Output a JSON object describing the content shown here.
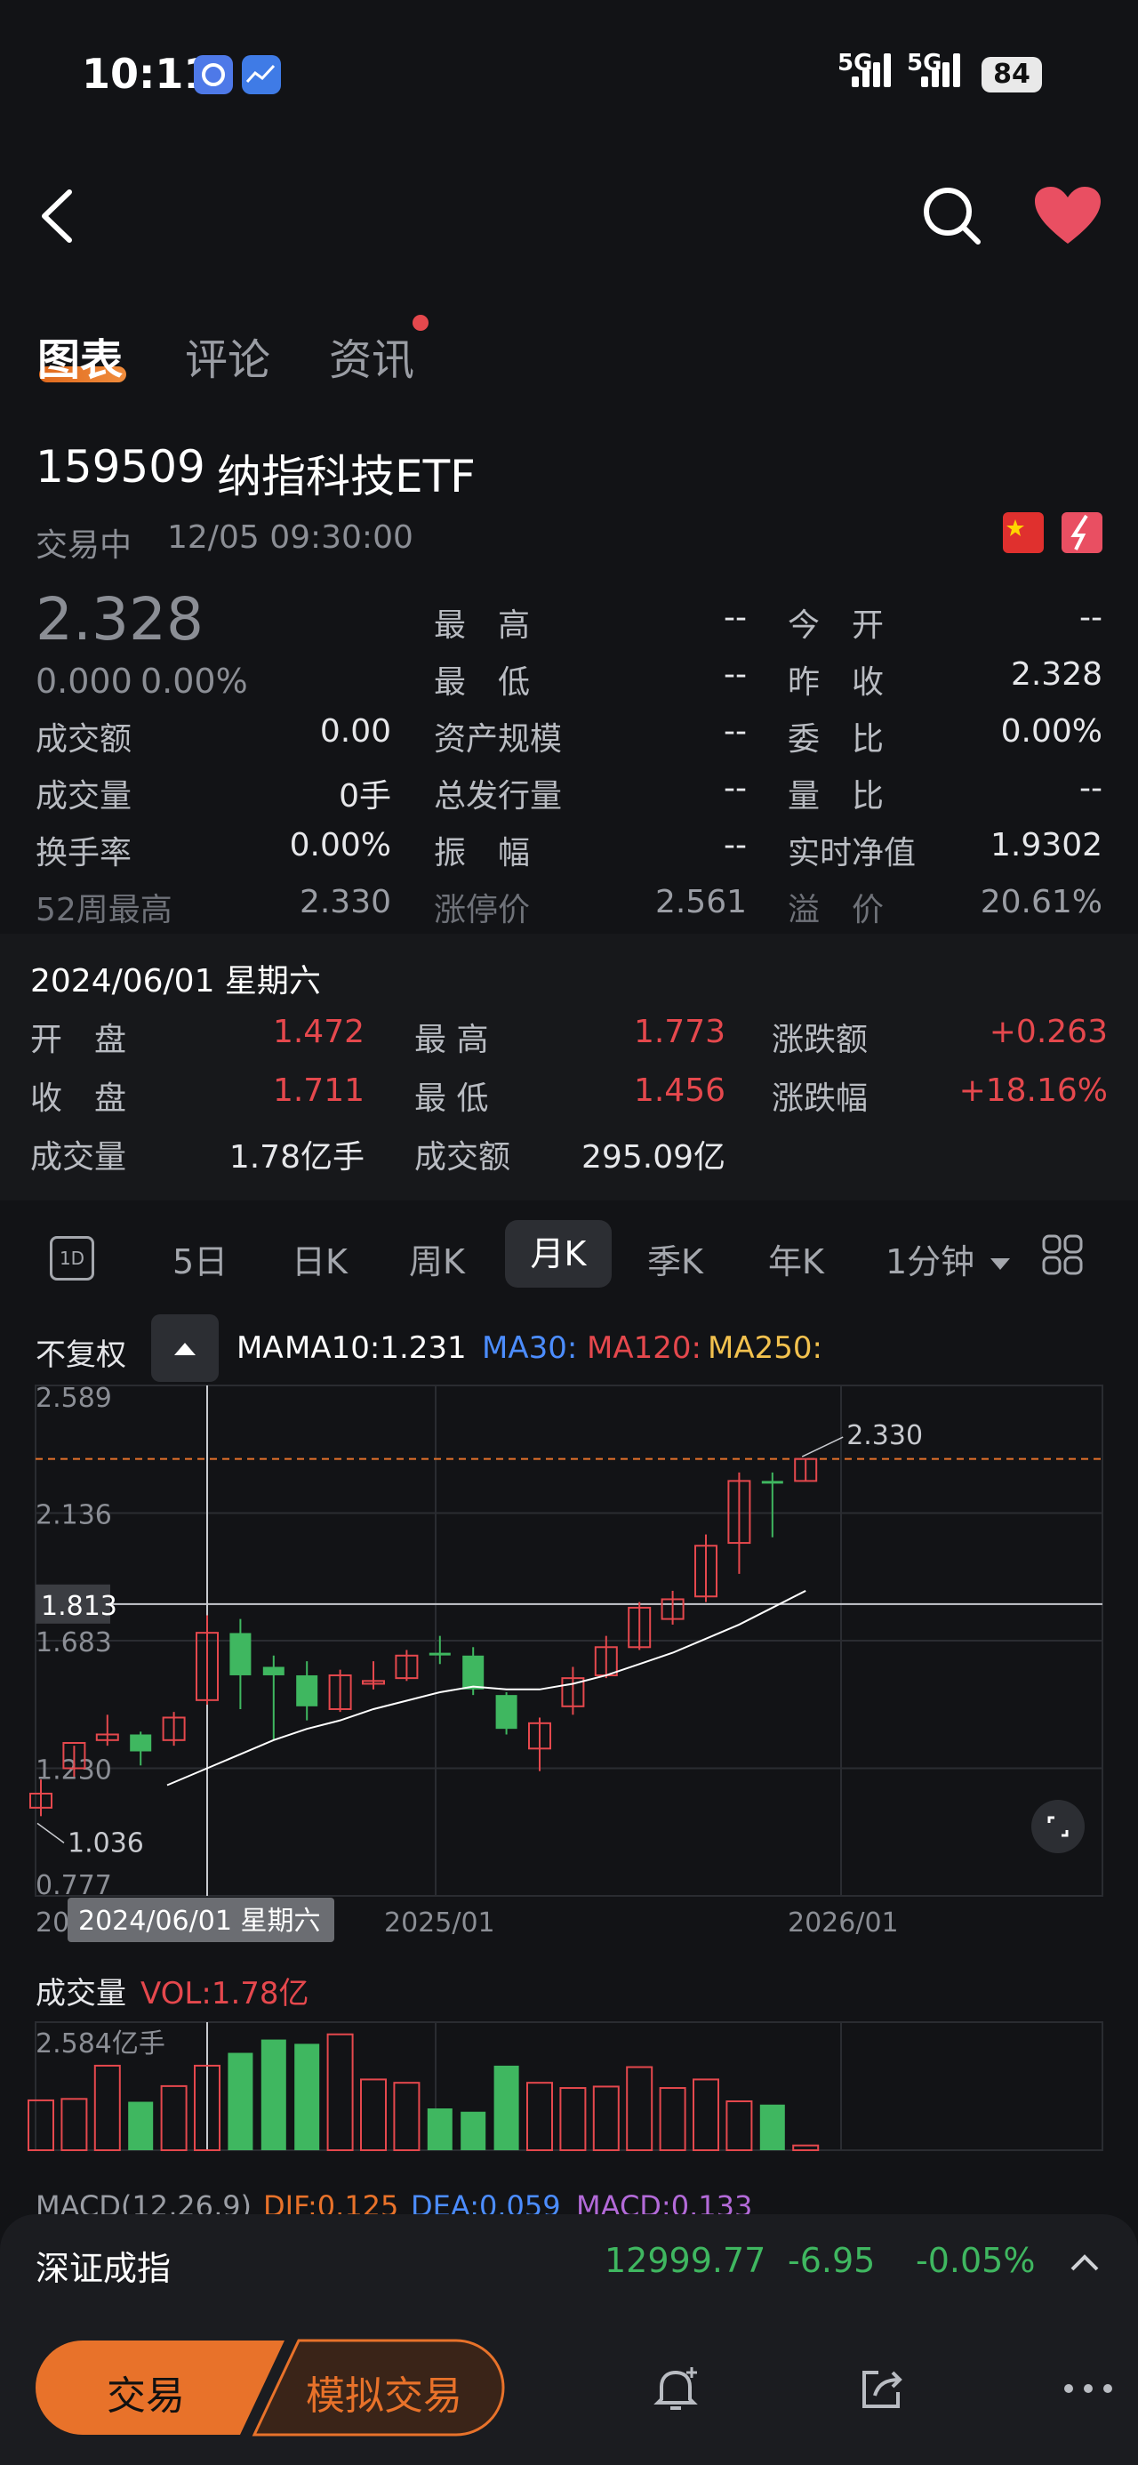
{
  "status_bar": {
    "time": "10:11",
    "signal1": "5G",
    "signal2": "5G",
    "battery": "84"
  },
  "tabs": [
    {
      "label": "图表"
    },
    {
      "label": "评论"
    },
    {
      "label": "资讯"
    }
  ],
  "security": {
    "code": "159509",
    "name": "纳指科技ETF",
    "status": "交易中",
    "datetime": "12/05 09:30:00",
    "price": "2.328",
    "change": "0.000",
    "change_pct": "0.00%"
  },
  "quote": {
    "high_label": "最　高",
    "high": "--",
    "open_label": "今　开",
    "open": "--",
    "low_label": "最　低",
    "low": "--",
    "prev_close_label": "昨　收",
    "prev_close": "2.328",
    "amount_label": "成交额",
    "amount": "0.00",
    "asset_label": "资产规模",
    "asset": "--",
    "ratio_label": "委　比",
    "ratio": "0.00%",
    "volume_label": "成交量",
    "volume": "0手",
    "issue_label": "总发行量",
    "issue": "--",
    "vol_ratio_label": "量　比",
    "vol_ratio": "--",
    "turnover_label": "换手率",
    "turnover": "0.00%",
    "amplitude_label": "振　幅",
    "amplitude": "--",
    "nav_label": "实时净值",
    "nav": "1.9302",
    "w52_label": "52周最高",
    "w52": "2.330",
    "limit_label": "涨停价",
    "limit": "2.561",
    "premium_label": "溢　价",
    "premium": "20.61%"
  },
  "detail": {
    "date": "2024/06/01 星期六",
    "open_label": "开　盘",
    "open": "1.472",
    "high_label": "最 高",
    "high": "1.773",
    "chg_label": "涨跌额",
    "chg": "+0.263",
    "close_label": "收　盘",
    "close": "1.711",
    "low_label": "最 低",
    "low": "1.456",
    "chg_pct_label": "涨跌幅",
    "chg_pct": "+18.16%",
    "vol_label": "成交量",
    "vol": "1.78亿手",
    "amt_label": "成交额",
    "amt": "295.09亿"
  },
  "period_tabs": {
    "d1": "1D",
    "five_day": "5日",
    "day_k": "日K",
    "week_k": "周K",
    "month_k": "月K",
    "quarter_k": "季K",
    "year_k": "年K",
    "minute": "1分钟"
  },
  "chart_header": {
    "adjust": "不复权",
    "ma": "MA",
    "ma10": "MA10:1.231",
    "ma30": "MA30:",
    "ma120": "MA120:",
    "ma250": "MA250:"
  },
  "colors": {
    "up": "#e5484d",
    "down": "#3fb760",
    "ma10": "#ffffff",
    "ma30": "#4c8dff",
    "ma120": "#e5484d",
    "ma250": "#f2c14e",
    "accent": "#e8722a"
  },
  "chart_data": {
    "type": "candlestick",
    "y_ticks": [
      "2.589",
      "2.136",
      "1.683",
      "1.230",
      "0.777"
    ],
    "ylim": [
      0.777,
      2.589
    ],
    "x_ticks": [
      "2025/01",
      "2026/01"
    ],
    "x_start_partial": "20",
    "crosshair_value": "1.813",
    "crosshair_date": "2024/06/01 星期六",
    "max_label": "2.330",
    "min_label": "1.036",
    "current_price": 2.328,
    "candles": [
      {
        "o": 1.14,
        "h": 1.19,
        "l": 1.06,
        "c": 1.09,
        "dir": "up"
      },
      {
        "o": 1.23,
        "h": 1.31,
        "l": 1.2,
        "c": 1.32,
        "dir": "up"
      },
      {
        "o": 1.33,
        "h": 1.42,
        "l": 1.31,
        "c": 1.35,
        "dir": "up"
      },
      {
        "o": 1.35,
        "h": 1.36,
        "l": 1.24,
        "c": 1.29,
        "dir": "down"
      },
      {
        "o": 1.33,
        "h": 1.43,
        "l": 1.31,
        "c": 1.41,
        "dir": "up"
      },
      {
        "o": 1.472,
        "h": 1.773,
        "l": 1.456,
        "c": 1.711,
        "dir": "up"
      },
      {
        "o": 1.71,
        "h": 1.76,
        "l": 1.44,
        "c": 1.56,
        "dir": "down"
      },
      {
        "o": 1.59,
        "h": 1.63,
        "l": 1.33,
        "c": 1.56,
        "dir": "down"
      },
      {
        "o": 1.56,
        "h": 1.61,
        "l": 1.4,
        "c": 1.45,
        "dir": "down"
      },
      {
        "o": 1.44,
        "h": 1.58,
        "l": 1.43,
        "c": 1.56,
        "dir": "up"
      },
      {
        "o": 1.53,
        "h": 1.61,
        "l": 1.51,
        "c": 1.54,
        "dir": "up"
      },
      {
        "o": 1.55,
        "h": 1.65,
        "l": 1.54,
        "c": 1.63,
        "dir": "up"
      },
      {
        "o": 1.64,
        "h": 1.7,
        "l": 1.6,
        "c": 1.64,
        "dir": "down"
      },
      {
        "o": 1.63,
        "h": 1.66,
        "l": 1.49,
        "c": 1.51,
        "dir": "down"
      },
      {
        "o": 1.49,
        "h": 1.5,
        "l": 1.35,
        "c": 1.37,
        "dir": "down"
      },
      {
        "o": 1.3,
        "h": 1.41,
        "l": 1.22,
        "c": 1.39,
        "dir": "up"
      },
      {
        "o": 1.45,
        "h": 1.59,
        "l": 1.42,
        "c": 1.55,
        "dir": "up"
      },
      {
        "o": 1.56,
        "h": 1.7,
        "l": 1.55,
        "c": 1.66,
        "dir": "up"
      },
      {
        "o": 1.66,
        "h": 1.82,
        "l": 1.65,
        "c": 1.8,
        "dir": "up"
      },
      {
        "o": 1.76,
        "h": 1.86,
        "l": 1.74,
        "c": 1.83,
        "dir": "up"
      },
      {
        "o": 1.84,
        "h": 2.06,
        "l": 1.82,
        "c": 2.02,
        "dir": "up"
      },
      {
        "o": 2.03,
        "h": 2.28,
        "l": 1.92,
        "c": 2.25,
        "dir": "up"
      },
      {
        "o": 2.25,
        "h": 2.28,
        "l": 2.05,
        "c": 2.25,
        "dir": "down"
      },
      {
        "o": 2.25,
        "h": 2.33,
        "l": 2.25,
        "c": 2.328,
        "dir": "up"
      }
    ],
    "ma10": [
      null,
      null,
      null,
      null,
      null,
      1.23,
      1.28,
      1.33,
      1.37,
      1.4,
      1.44,
      1.47,
      1.5,
      1.52,
      1.51,
      1.51,
      1.53,
      1.56,
      1.6,
      1.64,
      1.69,
      1.74,
      1.8,
      1.86
    ],
    "volume": {
      "label": "成交量",
      "value_label": "VOL:1.78亿",
      "max_label": "2.584亿手",
      "values": [
        1.05,
        1.08,
        1.78,
        1.02,
        1.35,
        1.78,
        2.05,
        2.33,
        2.24,
        2.44,
        1.49,
        1.42,
        0.88,
        0.81,
        1.78,
        1.42,
        1.31,
        1.34,
        1.75,
        1.31,
        1.49,
        1.03,
        0.96,
        0.1
      ],
      "dirs": [
        "up",
        "up",
        "up",
        "down",
        "up",
        "up",
        "down",
        "down",
        "down",
        "up",
        "up",
        "up",
        "down",
        "down",
        "down",
        "up",
        "up",
        "up",
        "up",
        "up",
        "up",
        "up",
        "down",
        "up"
      ]
    }
  },
  "macd": {
    "label": "MACD(12,26,9)",
    "dif": "DIF:0.125",
    "dea": "DEA:0.059",
    "macd": "MACD:0.133"
  },
  "ticker": {
    "name": "深证成指",
    "value": "12999.77",
    "change": "-6.95",
    "pct": "-0.05%"
  },
  "bottom_bar": {
    "trade": "交易",
    "mock_trade": "模拟交易"
  }
}
